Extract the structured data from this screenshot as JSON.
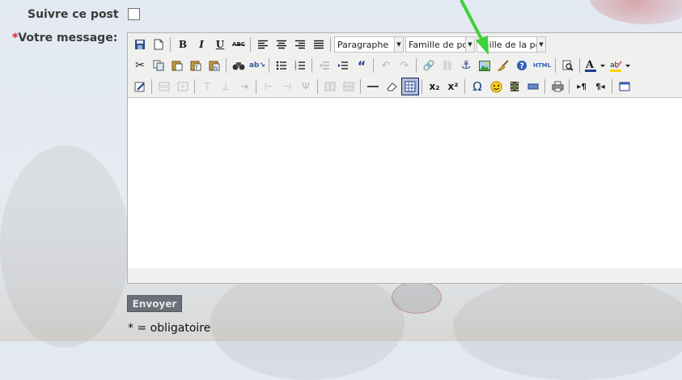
{
  "form": {
    "follow_label": "Suivre ce post",
    "message_required_mark": "*",
    "message_label": "Votre message:",
    "send_label": "Envoyer",
    "required_note": "* = obligatoire"
  },
  "toolbar": {
    "format_select": "Paragraphe",
    "font_family_select": "Famille de police",
    "font_size_select": "Taille de la police",
    "html_button_label": "HTML"
  },
  "colors": {
    "arrow": "#3dd13a",
    "send_bg": "#6c6f78",
    "required": "#e02020"
  }
}
